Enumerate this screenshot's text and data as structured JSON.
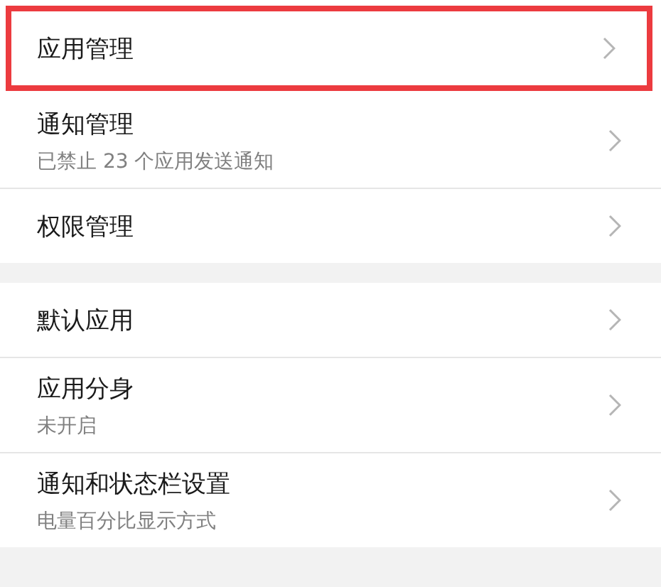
{
  "sections": [
    {
      "items": [
        {
          "title": "应用管理",
          "highlighted": true
        },
        {
          "title": "通知管理",
          "subtitle": "已禁止 23 个应用发送通知",
          "highlighted": false
        },
        {
          "title": "权限管理",
          "highlighted": false
        }
      ]
    },
    {
      "items": [
        {
          "title": "默认应用",
          "highlighted": false
        },
        {
          "title": "应用分身",
          "subtitle": "未开启",
          "highlighted": false
        },
        {
          "title": "通知和状态栏设置",
          "subtitle": "电量百分比显示方式",
          "highlighted": false
        }
      ]
    }
  ]
}
